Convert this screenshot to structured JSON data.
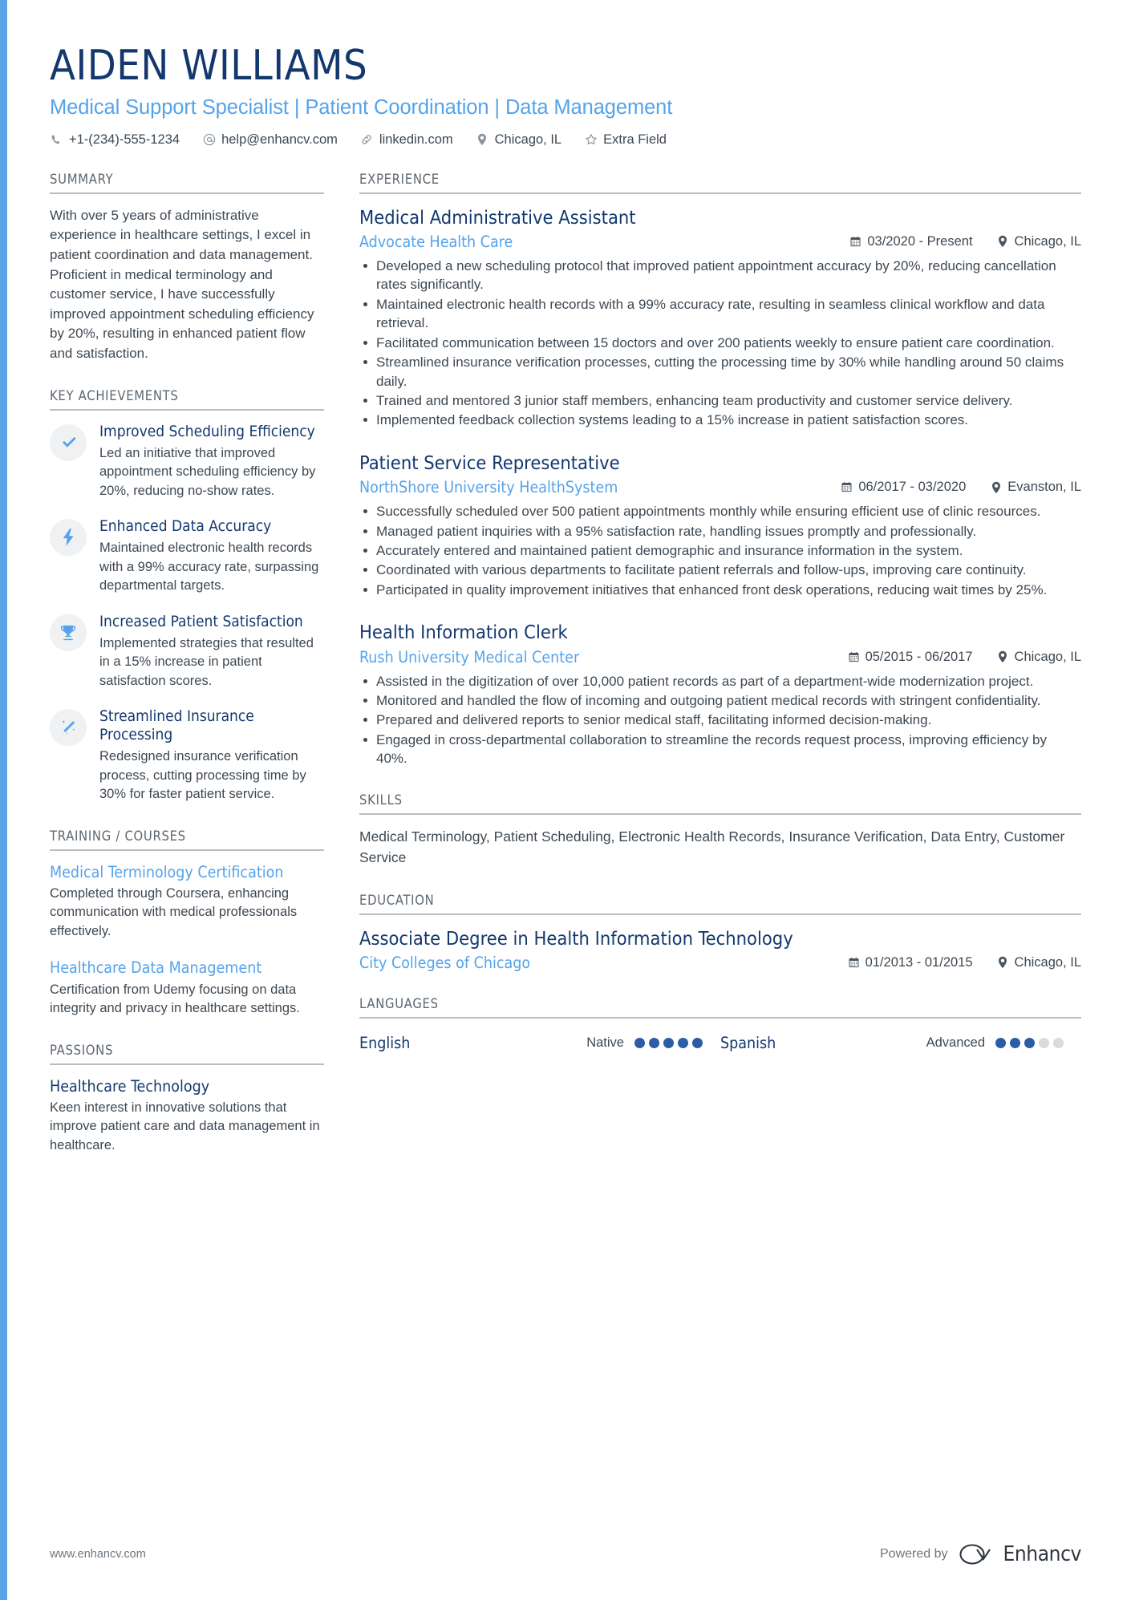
{
  "colors": {
    "navy": "#13386e",
    "accent_blue": "#54a3ea",
    "dot_filled": "#2b5ca6",
    "dot_empty": "#d9dbdd",
    "rule": "#b9bdc2",
    "body_text": "#3d4852"
  },
  "header": {
    "name": "AIDEN WILLIAMS",
    "headline": "Medical Support Specialist | Patient Coordination | Data Management",
    "contacts": [
      {
        "icon": "phone-icon",
        "text": "+1-(234)-555-1234"
      },
      {
        "icon": "email-icon",
        "text": "help@enhancv.com"
      },
      {
        "icon": "link-icon",
        "text": "linkedin.com"
      },
      {
        "icon": "location-icon",
        "text": "Chicago, IL"
      },
      {
        "icon": "star-icon",
        "text": "Extra Field"
      }
    ]
  },
  "left": {
    "summary": {
      "title": "SUMMARY",
      "text": "With over 5 years of administrative experience in healthcare settings, I excel in patient coordination and data management. Proficient in medical terminology and customer service, I have successfully improved appointment scheduling efficiency by 20%, resulting in enhanced patient flow and satisfaction."
    },
    "key_achievements": {
      "title": "KEY ACHIEVEMENTS",
      "items": [
        {
          "icon": "check-icon",
          "title": "Improved Scheduling Efficiency",
          "desc": "Led an initiative that improved appointment scheduling efficiency by 20%, reducing no-show rates."
        },
        {
          "icon": "lightning-bolt-icon",
          "title": "Enhanced Data Accuracy",
          "desc": "Maintained electronic health records with a 99% accuracy rate, surpassing departmental targets."
        },
        {
          "icon": "trophy-icon",
          "title": "Increased Patient Satisfaction",
          "desc": "Implemented strategies that resulted in a 15% increase in patient satisfaction scores."
        },
        {
          "icon": "magic-wand-icon",
          "title": "Streamlined Insurance Processing",
          "desc": "Redesigned insurance verification process, cutting processing time by 30% for faster patient service."
        }
      ]
    },
    "training": {
      "title": "TRAINING / COURSES",
      "items": [
        {
          "title": "Medical Terminology Certification",
          "desc": "Completed through Coursera, enhancing communication with medical professionals effectively."
        },
        {
          "title": "Healthcare Data Management",
          "desc": "Certification from Udemy focusing on data integrity and privacy in healthcare settings."
        }
      ]
    },
    "passions": {
      "title": "PASSIONS",
      "items": [
        {
          "title": "Healthcare Technology",
          "desc": "Keen interest in innovative solutions that improve patient care and data management in healthcare."
        }
      ]
    }
  },
  "right": {
    "experience": {
      "title": "EXPERIENCE",
      "jobs": [
        {
          "role": "Medical Administrative Assistant",
          "company": "Advocate Health Care",
          "date": "03/2020 - Present",
          "location": "Chicago, IL",
          "bullets": [
            "Developed a new scheduling protocol that improved patient appointment accuracy by 20%, reducing cancellation rates significantly.",
            "Maintained electronic health records with a 99% accuracy rate, resulting in seamless clinical workflow and data retrieval.",
            "Facilitated communication between 15 doctors and over 200 patients weekly to ensure patient care coordination.",
            "Streamlined insurance verification processes, cutting the processing time by 30% while handling around 50 claims daily.",
            "Trained and mentored 3 junior staff members, enhancing team productivity and customer service delivery.",
            "Implemented feedback collection systems leading to a 15% increase in patient satisfaction scores."
          ]
        },
        {
          "role": "Patient Service Representative",
          "company": "NorthShore University HealthSystem",
          "date": "06/2017 - 03/2020",
          "location": "Evanston, IL",
          "bullets": [
            "Successfully scheduled over 500 patient appointments monthly while ensuring efficient use of clinic resources.",
            "Managed patient inquiries with a 95% satisfaction rate, handling issues promptly and professionally.",
            "Accurately entered and maintained patient demographic and insurance information in the system.",
            "Coordinated with various departments to facilitate patient referrals and follow-ups, improving care continuity.",
            "Participated in quality improvement initiatives that enhanced front desk operations, reducing wait times by 25%."
          ]
        },
        {
          "role": "Health Information Clerk",
          "company": "Rush University Medical Center",
          "date": "05/2015 - 06/2017",
          "location": "Chicago, IL",
          "bullets": [
            "Assisted in the digitization of over 10,000 patient records as part of a department-wide modernization project.",
            "Monitored and handled the flow of incoming and outgoing patient medical records with stringent confidentiality.",
            "Prepared and delivered reports to senior medical staff, facilitating informed decision-making.",
            "Engaged in cross-departmental collaboration to streamline the records request process, improving efficiency by 40%."
          ]
        }
      ]
    },
    "skills": {
      "title": "SKILLS",
      "text": "Medical Terminology, Patient Scheduling, Electronic Health Records, Insurance Verification, Data Entry, Customer Service"
    },
    "education": {
      "title": "EDUCATION",
      "items": [
        {
          "degree": "Associate Degree in Health Information Technology",
          "school": "City Colleges of Chicago",
          "date": "01/2013 - 01/2015",
          "location": "Chicago, IL"
        }
      ]
    },
    "languages": {
      "title": "LANGUAGES",
      "items": [
        {
          "name": "English",
          "level": "Native",
          "filled": 5,
          "total": 5
        },
        {
          "name": "Spanish",
          "level": "Advanced",
          "filled": 3,
          "total": 5
        }
      ]
    }
  },
  "footer": {
    "url": "www.enhancv.com",
    "powered_by": "Powered by",
    "brand": "Enhancv"
  }
}
